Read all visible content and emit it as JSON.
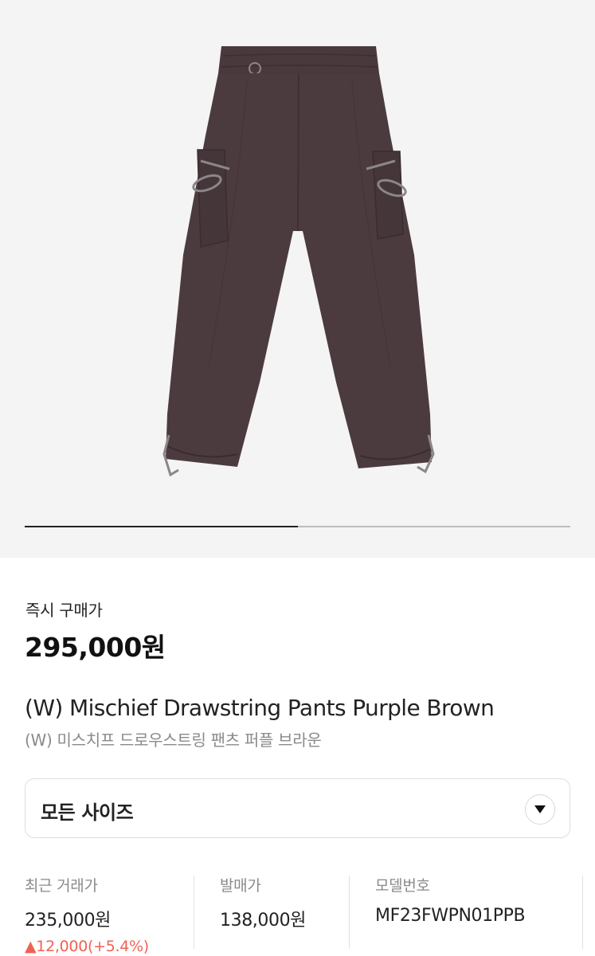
{
  "gallery": {
    "image": "purple-brown-drawstring-cargo-pants-photo",
    "slide_progress": 0.5,
    "colors": {
      "background": "#f4f4f4",
      "product": "#4c3b3e"
    }
  },
  "price": {
    "label": "즉시 구매가",
    "value": "295,000원"
  },
  "product": {
    "title_en": "(W) Mischief Drawstring Pants Purple Brown",
    "title_ko": "(W) 미스치프 드로우스트링 팬츠 퍼플 브라운"
  },
  "size_select": {
    "value": "모든 사이즈",
    "icon": "chevron-down-icon"
  },
  "stats": {
    "recent_trade": {
      "label": "최근 거래가",
      "value": "235,000원",
      "change": "▲12,000(+5.4%)",
      "change_color": "#ef6253"
    },
    "release_price": {
      "label": "발매가",
      "value": "138,000원"
    },
    "model_number": {
      "label": "모델번호",
      "value": "MF23FWPN01PPB"
    }
  }
}
